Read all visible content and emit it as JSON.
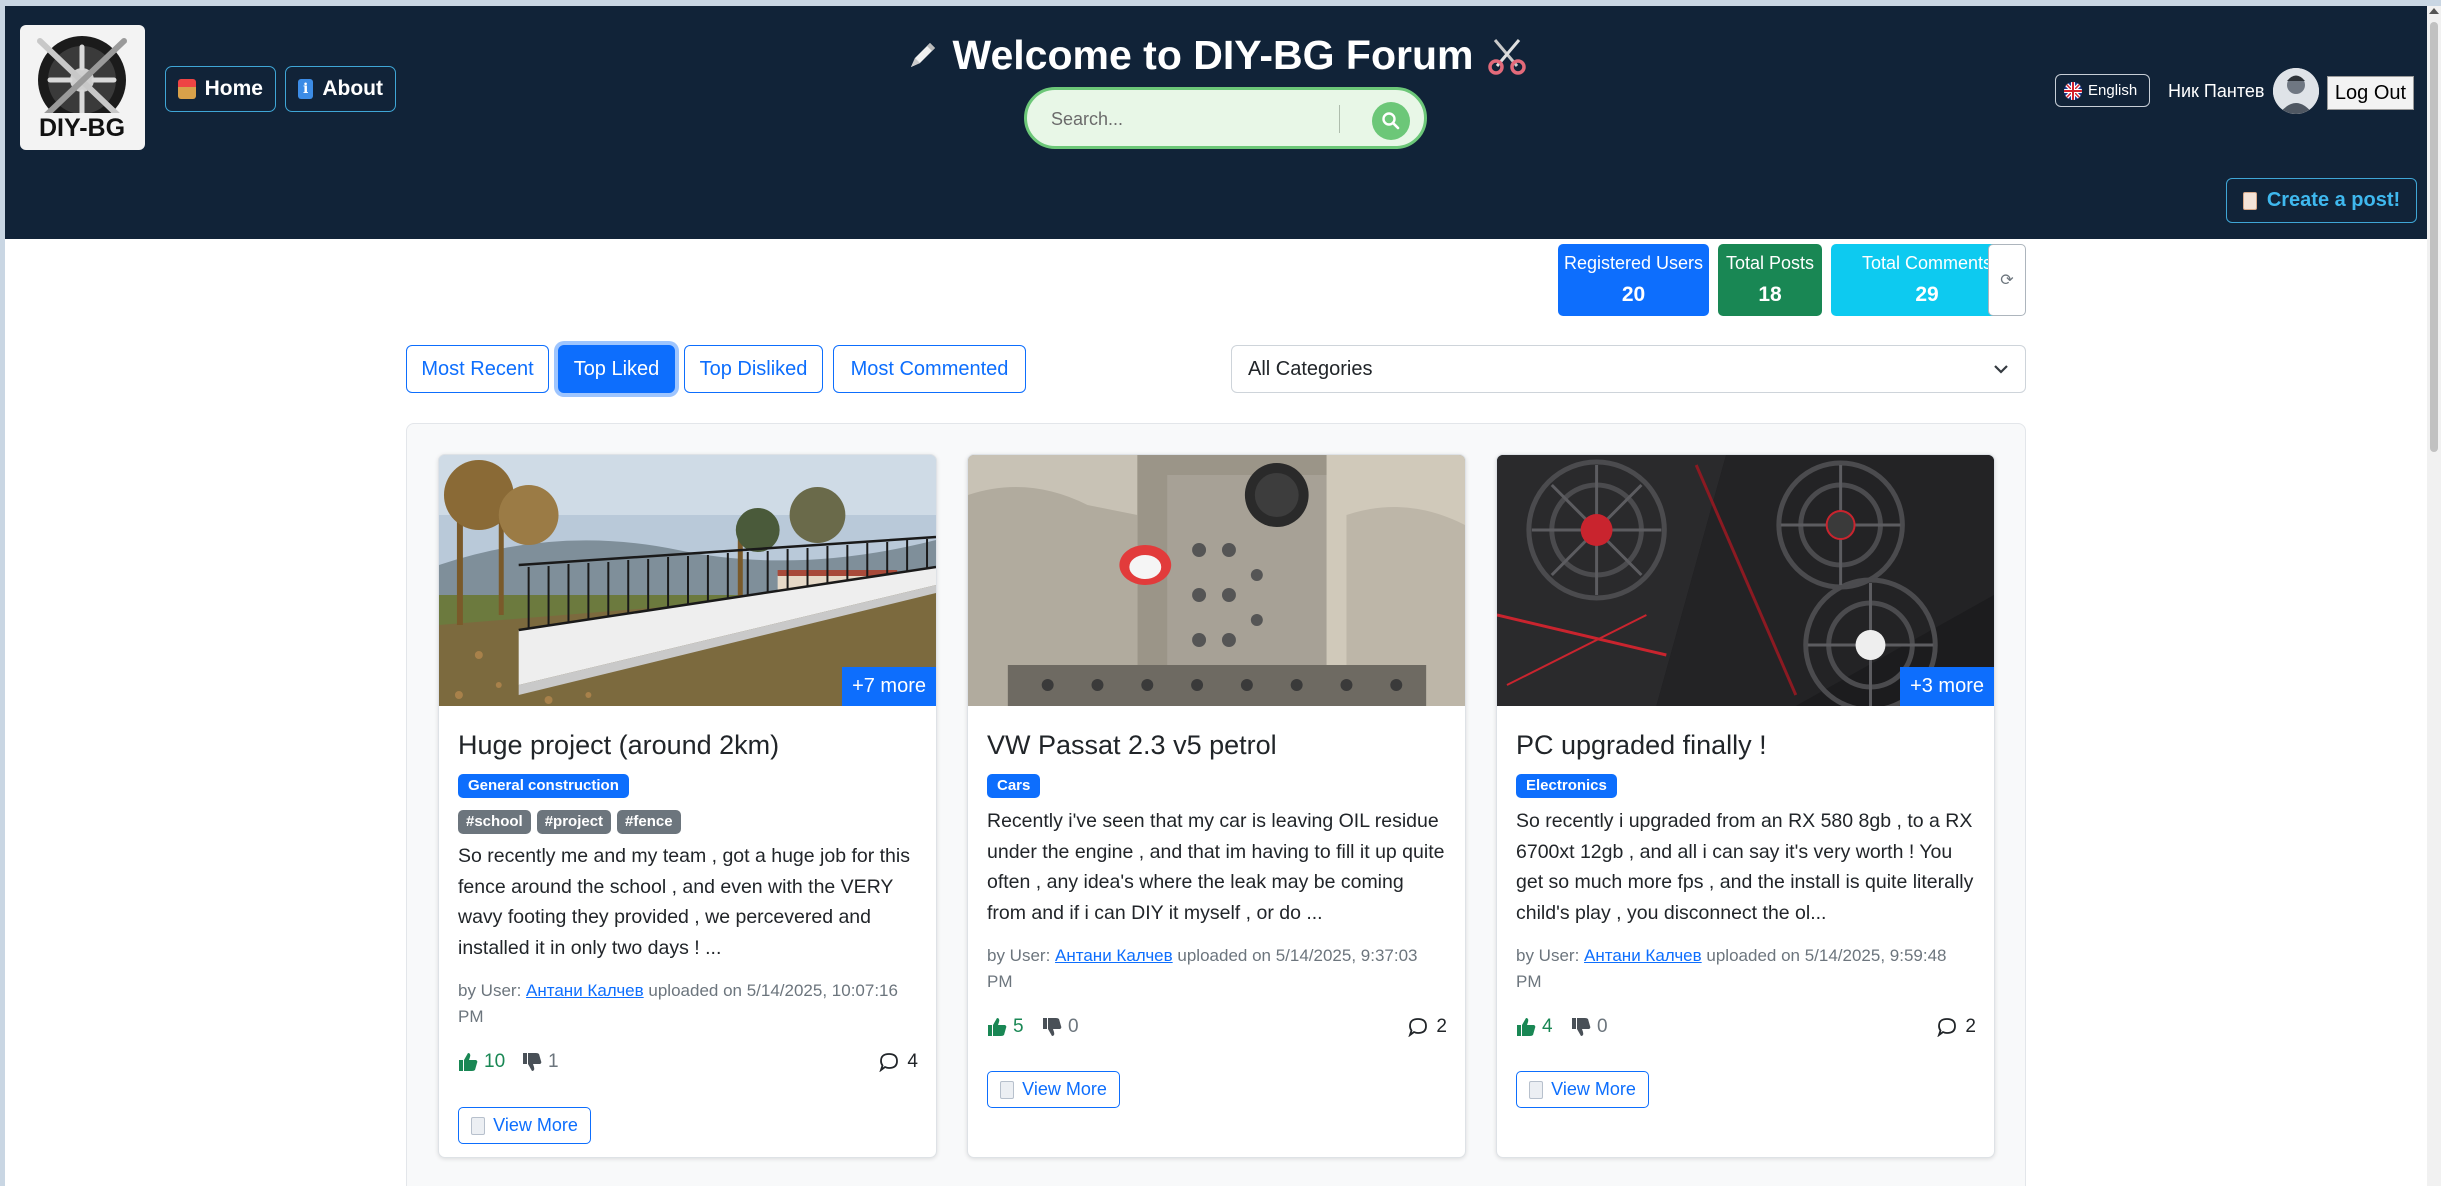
{
  "header": {
    "title": "Welcome to DIY-BG Forum",
    "logo_text": "DIY-BG",
    "nav": [
      {
        "label": "Home",
        "icon": "house-icon"
      },
      {
        "label": "About",
        "icon": "info-icon"
      }
    ],
    "search_placeholder": "Search...",
    "language": "English",
    "user_name": "Ник Пантев",
    "logout_label": "Log Out",
    "create_post_label": "Create a post!"
  },
  "stats": {
    "users_label": "Registered Users",
    "users_value": "20",
    "posts_label": "Total Posts",
    "posts_value": "18",
    "comments_label": "Total Comments",
    "comments_value": "29",
    "refresh_glyph": "⟳"
  },
  "filters": {
    "buttons": [
      "Most Recent",
      "Top Liked",
      "Top Disliked",
      "Most Commented"
    ],
    "active": "Top Liked",
    "category_selected": "All Categories"
  },
  "posts": [
    {
      "title": "Huge project (around 2km)",
      "category": "General construction",
      "tags": [
        "#school",
        "#project",
        "#fence"
      ],
      "more_images": "+7 more",
      "excerpt": "So recently me and my team , got a huge job for this fence around the school , and even with the VERY wavy footing they provided , we percevered and installed it in only two days ! ...",
      "meta_prefix": "by User: ",
      "author": "Антани Калчев",
      "meta_suffix": " uploaded on 5/14/2025, 10:07:16 PM",
      "likes": "10",
      "dislikes": "1",
      "comments": "4",
      "view_more": "View More"
    },
    {
      "title": "VW Passat 2.3 v5 petrol",
      "category": "Cars",
      "tags": [],
      "more_images": "",
      "excerpt": "Recently i've seen that my car is leaving OIL residue under the engine , and that im having to fill it up quite often , any idea's where the leak may be coming from and if i can DIY it myself , or do ...",
      "meta_prefix": "by User: ",
      "author": "Антани Калчев",
      "meta_suffix": " uploaded on 5/14/2025, 9:37:03 PM",
      "likes": "5",
      "dislikes": "0",
      "comments": "2",
      "view_more": "View More"
    },
    {
      "title": "PC upgraded finally !",
      "category": "Electronics",
      "tags": [],
      "more_images": "+3 more",
      "excerpt": "So recently i upgraded from an RX 580 8gb , to a RX 6700xt 12gb , and all i can say it's very worth ! You get so much more fps , and the install is quite literally child's play , you disconnect the ol...",
      "meta_prefix": "by User: ",
      "author": "Антани Калчев",
      "meta_suffix": " uploaded on 5/14/2025, 9:59:48 PM",
      "likes": "4",
      "dislikes": "0",
      "comments": "2",
      "view_more": "View More"
    }
  ],
  "colors": {
    "navbar": "#112338",
    "primary": "#0d6efd",
    "success": "#198754",
    "info": "#0dcaf0",
    "search_green": "#6cc778"
  }
}
